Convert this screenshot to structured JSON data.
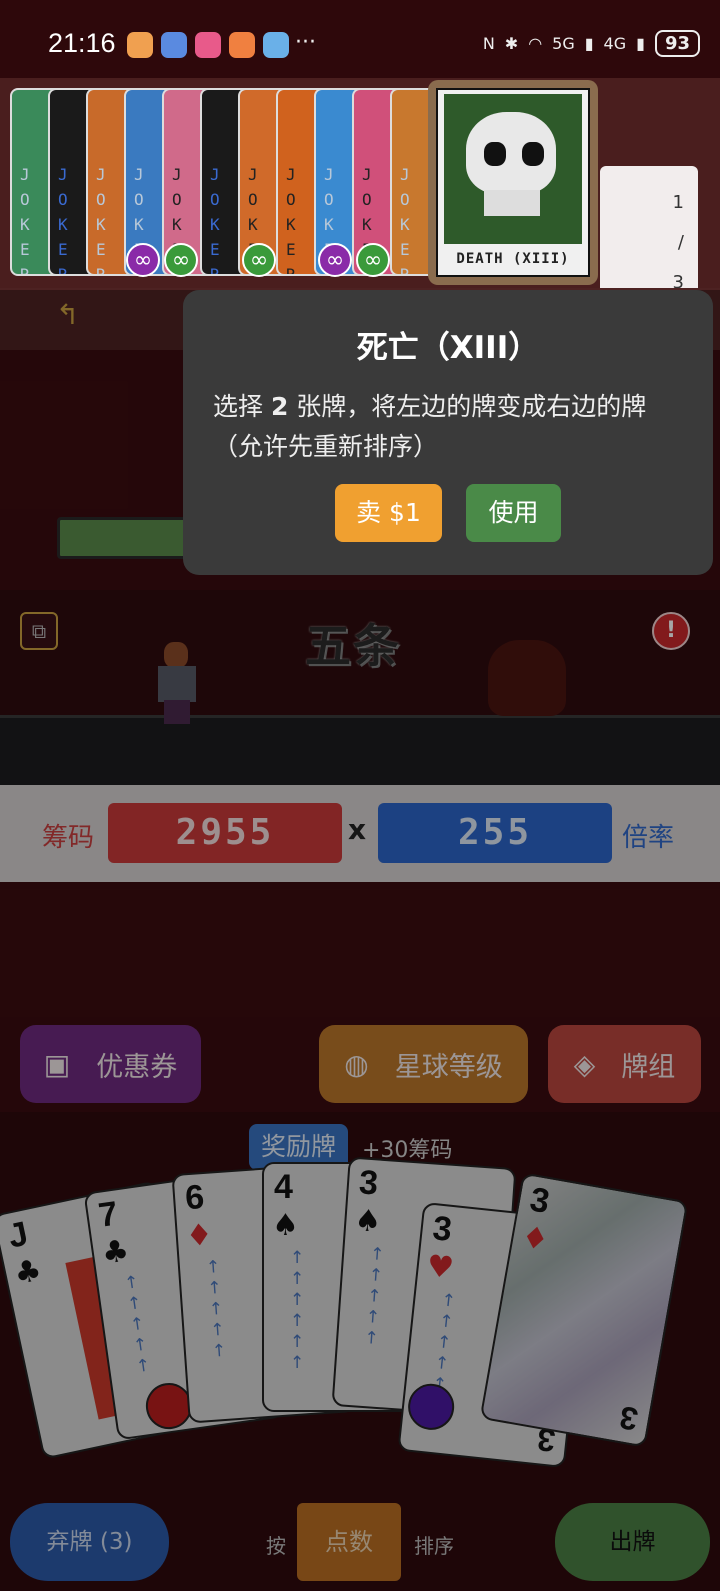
{
  "status_bar": {
    "time": "21:16",
    "more": "···",
    "network_5g": "5G",
    "network_4g": "4G",
    "battery": "93"
  },
  "jokers": {
    "card_text": "JOKER",
    "badge": "∞",
    "active_card_title": "DEATH (XIII)",
    "slot_counter": [
      "1",
      "/",
      "3"
    ]
  },
  "tooltip": {
    "title": "死亡（XIII）",
    "desc_before": "选择 ",
    "desc_num": "2",
    "desc_after": " 张牌，将左边的牌变成右边的牌（允许先重新排序）",
    "sell_label": "卖 $1",
    "use_label": "使用"
  },
  "battle": {
    "combo_name": "五条",
    "alert_glyph": "!",
    "back_glyph": "↰"
  },
  "score": {
    "chips_label": "筹码",
    "chips_value": "2955",
    "times": "x",
    "mult_value": "255",
    "mult_label": "倍率"
  },
  "actions": {
    "voucher_label": "优惠券",
    "planet_label": "星球等级",
    "deck_label": "牌组"
  },
  "hand": {
    "bonus_tag": "奖励牌",
    "bonus_text": "+30筹码",
    "cards": [
      {
        "rank": "J",
        "suit": "♣"
      },
      {
        "rank": "7",
        "suit": "♣"
      },
      {
        "rank": "6",
        "suit": "♦"
      },
      {
        "rank": "4",
        "suit": "♠"
      },
      {
        "rank": "3",
        "suit": "♠"
      },
      {
        "rank": "3",
        "suit": "♥"
      },
      {
        "rank": "3",
        "suit": "♦"
      }
    ]
  },
  "controls": {
    "discard_label": "弃牌 (3)",
    "sort_by": "按",
    "sort_value": "点数",
    "sort_suffix": "排序",
    "play_label": "出牌"
  },
  "colors": {
    "chips_red": "#c83a3a",
    "mult_blue": "#2c64c8",
    "sell_orange": "#f0a030",
    "use_green": "#4a8a48"
  }
}
